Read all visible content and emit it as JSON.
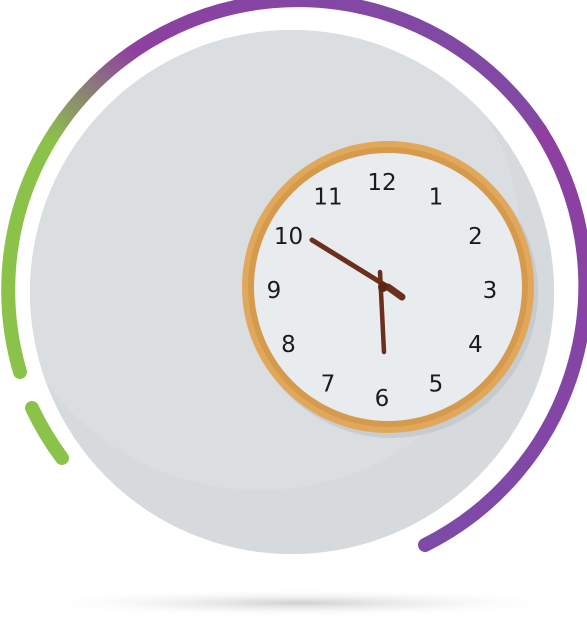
{
  "scene": {
    "ring_gradient": {
      "green": "#8bc34a",
      "purple": "#8e3fa0",
      "violet": "#7a4ea6"
    },
    "photo_background": "#d3d7da",
    "shadow_color": "#d9d9d9"
  },
  "clock": {
    "frame_color": "#e1a85b",
    "face_color": "#e8ecef",
    "hand_color": "#6b2f1c",
    "numerals": [
      "12",
      "1",
      "2",
      "3",
      "4",
      "5",
      "6",
      "7",
      "8",
      "9",
      "10",
      "11"
    ],
    "time_shown": "10:31"
  }
}
